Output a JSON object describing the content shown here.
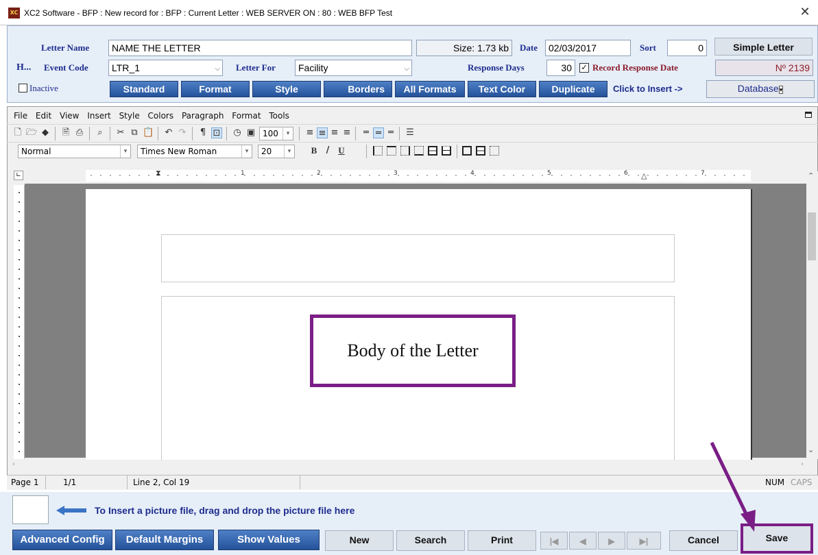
{
  "window": {
    "title": "XC2 Software - BFP : New record for : BFP : Current Letter : WEB SERVER ON : 80 : WEB BFP Test",
    "logo": "XC"
  },
  "form": {
    "letter_name_label": "Letter Name",
    "letter_name_value": "NAME THE LETTER",
    "size_label": "Size:",
    "size_value": "1.73 kb",
    "date_label": "Date",
    "date_value": "02/03/2017",
    "sort_label": "Sort",
    "sort_value": "0",
    "simple_letter_button": "Simple Letter",
    "h_button": "H...",
    "event_code_label": "Event Code",
    "event_code_value": "LTR_1",
    "letter_for_label": "Letter For",
    "letter_for_value": "Facility",
    "response_days_label": "Response Days",
    "response_days_value": "30",
    "record_response_label": "Record Response Date",
    "record_response_checked": true,
    "record_number": "Nº 2139",
    "inactive_label": "Inactive",
    "inactive_checked": false,
    "tabs": [
      "Standard",
      "Format",
      "Style",
      "Borders",
      "All Formats",
      "Text Color",
      "Duplicate"
    ],
    "click_insert_label": "Click to Insert ->",
    "insert_select_value": "Database"
  },
  "editor": {
    "menu": [
      "File",
      "Edit",
      "View",
      "Insert",
      "Style",
      "Colors",
      "Paragraph",
      "Format",
      "Tools"
    ],
    "zoom_value": "100",
    "style_value": "Normal",
    "font_value": "Times New Roman",
    "size_value": "20",
    "bold": "B",
    "italic": "/",
    "underline": "U",
    "ruler_numbers": [
      "1",
      "2",
      "3",
      "4",
      "5",
      "6",
      "7"
    ],
    "body_text": "Body of the Letter"
  },
  "status": {
    "page": "Page 1",
    "pages": "1/1",
    "position": "Line 2, Col 19",
    "num": "NUM",
    "caps": "CAPS"
  },
  "bottom": {
    "insert_hint": "To Insert a picture file, drag and drop the picture file here",
    "advanced_config": "Advanced Config",
    "default_margins": "Default Margins",
    "show_values": "Show Values",
    "new": "New",
    "search": "Search",
    "print": "Print",
    "cancel": "Cancel",
    "save": "Save"
  },
  "colors": {
    "label_blue": "#1d2c8c",
    "tab_blue": "#2f5ea8",
    "highlight_purple": "#7a1e86"
  }
}
